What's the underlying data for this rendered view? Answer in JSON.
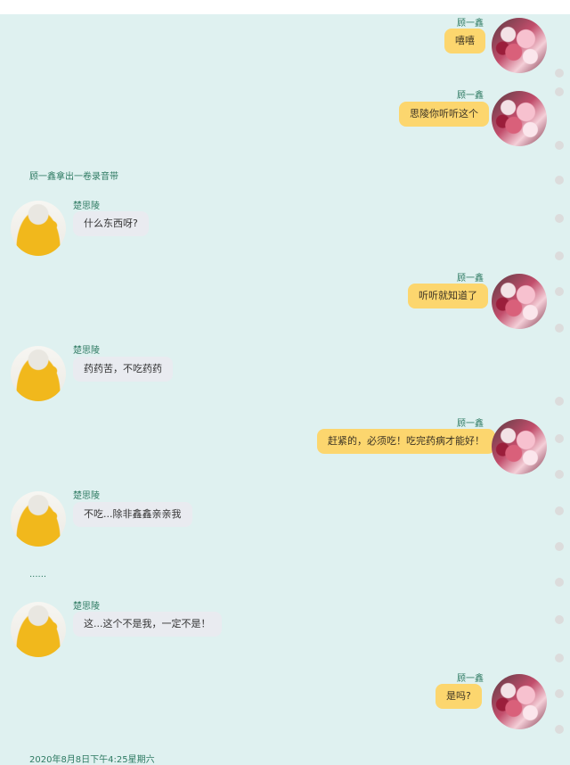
{
  "chat": {
    "messages": [
      {
        "side": "right",
        "sender": "顾一鑫",
        "text": "嘻嘻"
      },
      {
        "side": "right",
        "sender": "顾一鑫",
        "text": "思陵你听听这个"
      },
      {
        "side": "narration",
        "text": "顾一鑫拿出一卷录音带"
      },
      {
        "side": "left",
        "sender": "楚思陵",
        "text": "什么东西呀?"
      },
      {
        "side": "right",
        "sender": "顾一鑫",
        "text": "听听就知道了"
      },
      {
        "side": "left",
        "sender": "楚思陵",
        "text": "药药苦，不吃药药"
      },
      {
        "side": "right",
        "sender": "顾一鑫",
        "text": "赶紧的，必须吃！吃完药病才能好！"
      },
      {
        "side": "left",
        "sender": "楚思陵",
        "text": "不吃...除非鑫鑫亲亲我"
      },
      {
        "side": "narration",
        "text": "......"
      },
      {
        "side": "left",
        "sender": "楚思陵",
        "text": "这...这个不是我，一定不是！"
      },
      {
        "side": "right",
        "sender": "顾一鑫",
        "text": "是吗?"
      }
    ],
    "timestamp": "2020年8月8日下午4:25星期六"
  },
  "avatars": {
    "right": "flower-photo",
    "left": "yellow-sweater-girl"
  },
  "colors": {
    "background": "#dff1f0",
    "right_bubble": "#fcd66e",
    "left_bubble": "#e9ebf0",
    "name_text": "#2e7a62"
  }
}
